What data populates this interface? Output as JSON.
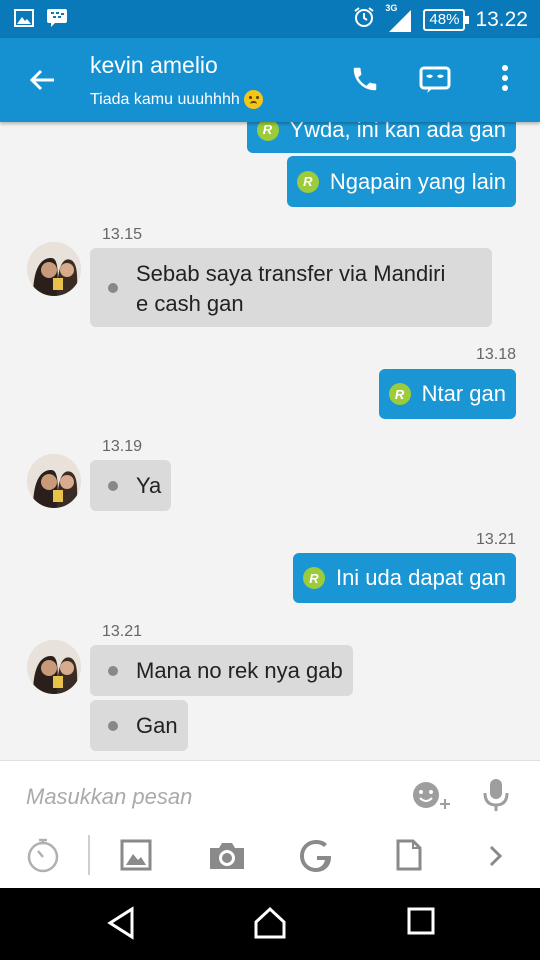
{
  "status_bar": {
    "network": "3G",
    "battery": "48%",
    "time": "13.22"
  },
  "header": {
    "contact_name": "kevin amelio",
    "status_message": "Tiada kamu uuuhhhh"
  },
  "messages": [
    {
      "direction": "out",
      "text": "Ywda, ini kan ada gan"
    },
    {
      "direction": "out",
      "text": "Ngapain yang lain"
    },
    {
      "direction": "in",
      "time": "13.15",
      "lines": [
        "Sebab saya transfer via Mandiri",
        "e cash gan"
      ]
    },
    {
      "direction": "out",
      "time": "13.18",
      "text": "Ntar gan"
    },
    {
      "direction": "in",
      "time": "13.19",
      "text": "Ya"
    },
    {
      "direction": "out",
      "time": "13.21",
      "text": "Ini uda dapat gan"
    },
    {
      "direction": "in",
      "time": "13.21",
      "text": "Mana no rek nya gab"
    },
    {
      "direction": "in",
      "text": "Gan"
    }
  ],
  "read_badge": "R",
  "composer": {
    "placeholder": "Masukkan pesan"
  },
  "colors": {
    "status_bar": "#0a79b9",
    "app_bar": "#1591d1",
    "outgoing_bubble": "#1a96d4",
    "incoming_bubble": "#dadada",
    "read_badge": "#9ccb3b"
  }
}
